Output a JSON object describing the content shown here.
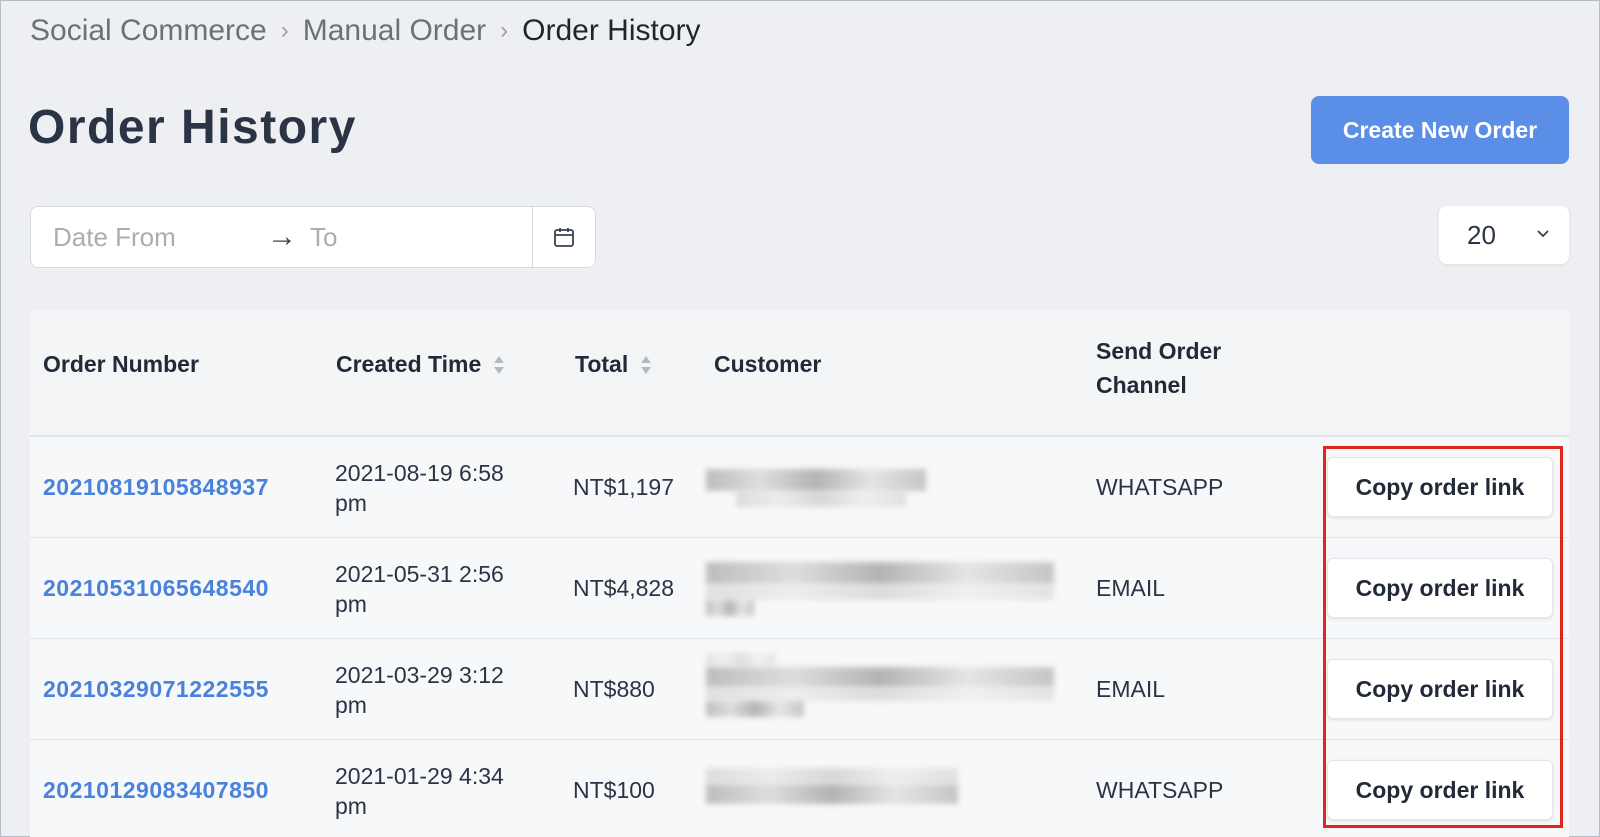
{
  "breadcrumb": [
    "Social Commerce",
    "Manual Order",
    "Order History"
  ],
  "page_title": "Order History",
  "create_button": "Create New Order",
  "date_filter": {
    "from_placeholder": "Date From",
    "to_placeholder": "To"
  },
  "page_size": "20",
  "table": {
    "columns": {
      "order_number": "Order Number",
      "created_time": "Created Time",
      "total": "Total",
      "customer": "Customer",
      "channel_line1": "Send Order",
      "channel_line2": "Channel"
    },
    "rows": [
      {
        "order": "20210819105848937",
        "date": "2021-08-19 6:58",
        "ampm": "pm",
        "total": "NT$1,197",
        "channel": "WHATSAPP",
        "action": "Copy order link"
      },
      {
        "order": "20210531065648540",
        "date": "2021-05-31 2:56",
        "ampm": "pm",
        "total": "NT$4,828",
        "channel": "EMAIL",
        "action": "Copy order link"
      },
      {
        "order": "20210329071222555",
        "date": "2021-03-29 3:12",
        "ampm": "pm",
        "total": "NT$880",
        "channel": "EMAIL",
        "action": "Copy order link"
      },
      {
        "order": "20210129083407850",
        "date": "2021-01-29 4:34",
        "ampm": "pm",
        "total": "NT$100",
        "channel": "WHATSAPP",
        "action": "Copy order link"
      }
    ]
  },
  "colors": {
    "accent": "#5b8ee6",
    "link": "#4a82db",
    "highlight": "#e0261f"
  }
}
